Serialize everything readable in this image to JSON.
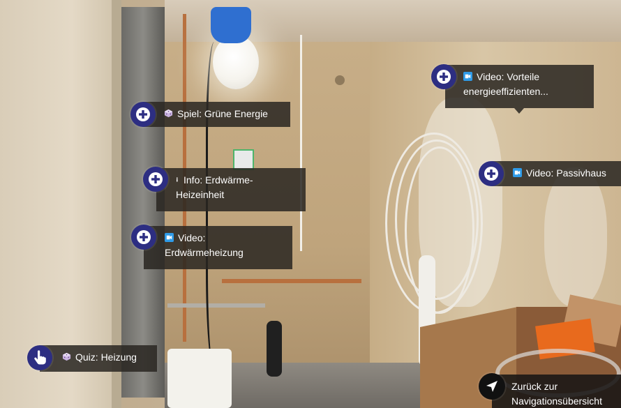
{
  "hotspots": {
    "spiel": {
      "label": "Spiel: Grüne Energie",
      "type_icon": "dice-icon"
    },
    "info": {
      "label": "Info: Erdwärme-Heizeinheit",
      "type_icon": "info-icon"
    },
    "video_erdwaerme": {
      "label": "Video: Erdwärmeheizung",
      "type_icon": "video-icon"
    },
    "video_vorteile": {
      "label": "Video: Vorteile energieeffizienten...",
      "type_icon": "video-icon"
    },
    "video_passivhaus": {
      "label": "Video: Passivhaus",
      "type_icon": "video-icon"
    },
    "quiz": {
      "label": "Quiz: Heizung",
      "type_icon": "dice-icon",
      "button_icon": "hand-pointer-icon"
    },
    "navigation": {
      "label": "Zurück zur Navigationsübersicht",
      "button_icon": "navigation-arrow-icon"
    }
  },
  "colors": {
    "hotspot_button": "#2d2e82",
    "label_background": "#2a2622",
    "video_icon": "#2f9be8",
    "nav_button": "#111111"
  }
}
